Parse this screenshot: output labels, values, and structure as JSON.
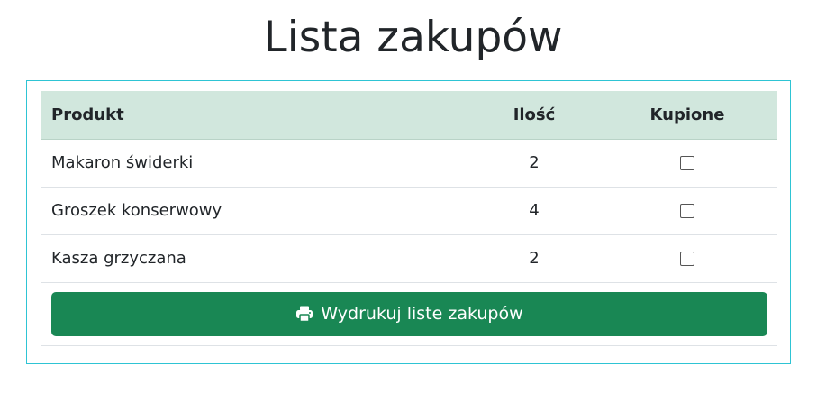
{
  "page": {
    "title": "Lista zakupów"
  },
  "table": {
    "headers": {
      "product": "Produkt",
      "quantity": "Ilość",
      "bought": "Kupione"
    },
    "rows": [
      {
        "product": "Makaron świderki",
        "quantity": "2",
        "bought": false
      },
      {
        "product": "Groszek konserwowy",
        "quantity": "4",
        "bought": false
      },
      {
        "product": "Kasza grzyczana",
        "quantity": "2",
        "bought": false
      }
    ]
  },
  "print_button": {
    "label": "Wydrukuj liste zakupów",
    "icon": "printer-icon"
  },
  "colors": {
    "header_bg": "#d1e7dd",
    "button_bg": "#198754",
    "card_border": "#2ec4d4"
  }
}
